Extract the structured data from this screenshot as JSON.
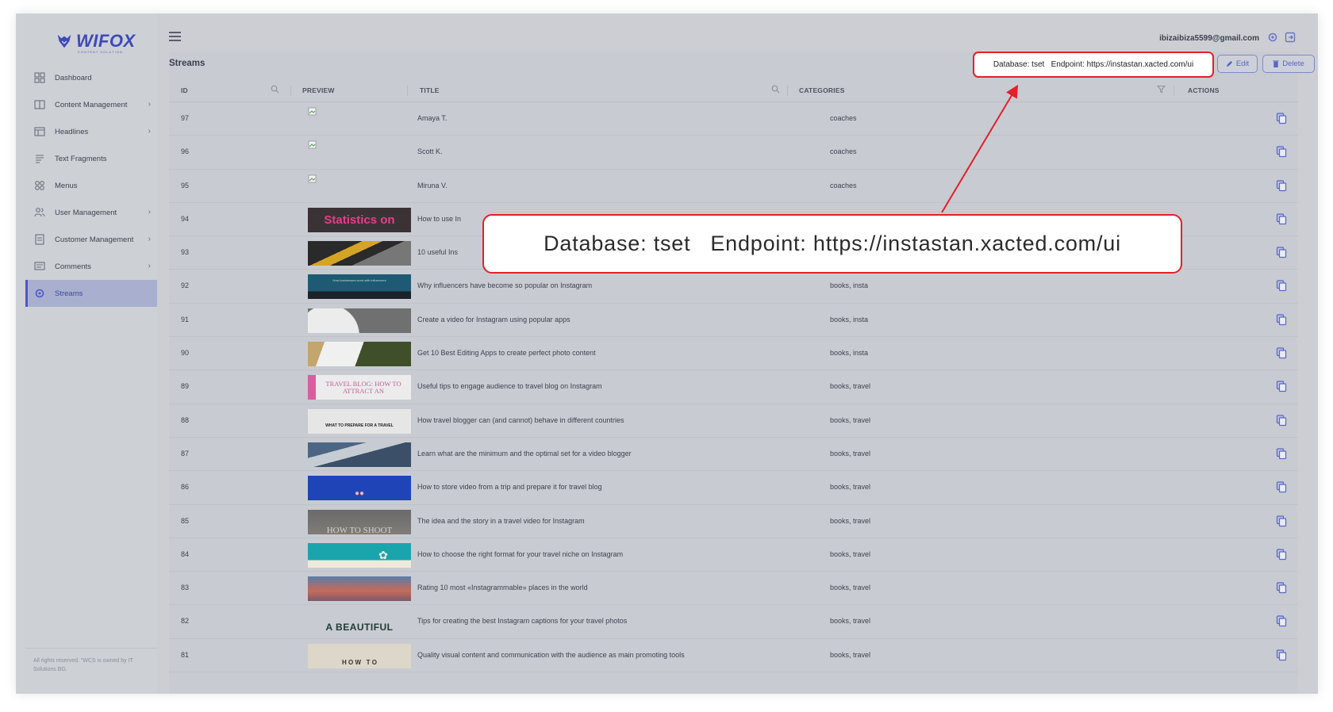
{
  "brand": {
    "name": "WIFOX",
    "tagline": "CONTENT SOLUTION"
  },
  "sidebar": {
    "items": [
      {
        "label": "Dashboard",
        "icon": "dashboard-icon",
        "chevron": false
      },
      {
        "label": "Content Management",
        "icon": "content-icon",
        "chevron": true
      },
      {
        "label": "Headlines",
        "icon": "headlines-icon",
        "chevron": true
      },
      {
        "label": "Text Fragments",
        "icon": "text-icon",
        "chevron": false
      },
      {
        "label": "Menus",
        "icon": "menus-icon",
        "chevron": false
      },
      {
        "label": "User Management",
        "icon": "users-icon",
        "chevron": true
      },
      {
        "label": "Customer Management",
        "icon": "customer-icon",
        "chevron": true
      },
      {
        "label": "Comments",
        "icon": "comments-icon",
        "chevron": true
      },
      {
        "label": "Streams",
        "icon": "streams-icon",
        "chevron": false,
        "active": true
      }
    ],
    "footer": "All rights reserved. \"WCS is owned by IT Solutions BG."
  },
  "header": {
    "user_email": "ibizaibiza5599@gmail.com"
  },
  "page": {
    "title": "Streams",
    "edit_label": "Edit",
    "delete_label": "Delete",
    "db_info": "Database: tset   Endpoint: https://instastan.xacted.com/ui"
  },
  "callout": {
    "text": "Database: tset   Endpoint: https://instastan.xacted.com/ui",
    "color": "#e3202b"
  },
  "table": {
    "columns": [
      "ID",
      "PREVIEW",
      "TITLE",
      "CATEGORIES",
      "ACTIONS"
    ],
    "rows": [
      {
        "id": "97",
        "title": "Amaya T.",
        "categories": "coaches",
        "preview": "broken"
      },
      {
        "id": "96",
        "title": "Scott K.",
        "categories": "coaches",
        "preview": "broken"
      },
      {
        "id": "95",
        "title": "Miruna V.",
        "categories": "coaches",
        "preview": "broken"
      },
      {
        "id": "94",
        "title": "How to use In",
        "categories": "",
        "preview": "stats",
        "preview_text": "Statistics on"
      },
      {
        "id": "93",
        "title": "10 useful Ins",
        "categories": "",
        "preview": "stripe"
      },
      {
        "id": "92",
        "title": "Why influencers have become so popular on Instagram",
        "categories": "books, insta",
        "preview": "teal",
        "preview_text": "How businesses work with influencers"
      },
      {
        "id": "91",
        "title": "Create a video for Instagram using popular apps",
        "categories": "books, insta",
        "preview": "gray"
      },
      {
        "id": "90",
        "title": "Get 10 Best Editing Apps to create perfect photo content",
        "categories": "books, insta",
        "preview": "phone"
      },
      {
        "id": "89",
        "title": "Useful tips to engage audience to travel blog on Instagram",
        "categories": "books, travel",
        "preview": "travel",
        "preview_text": "TRAVEL BLOG: HOW TO ATTRACT AN"
      },
      {
        "id": "88",
        "title": "How travel blogger can (and cannot) behave in different countries",
        "categories": "books, travel",
        "preview": "prepare",
        "preview_text": "WHAT TO PREPARE FOR A TRAVEL"
      },
      {
        "id": "87",
        "title": "Learn what are the minimum and the optimal set for a video blogger",
        "categories": "books, travel",
        "preview": "mountain"
      },
      {
        "id": "86",
        "title": "How to store video from a trip and prepare it for travel blog",
        "categories": "books, travel",
        "preview": "blue"
      },
      {
        "id": "85",
        "title": "The idea and the story in a travel video for Instagram",
        "categories": "books, travel",
        "preview": "shoot",
        "preview_text": "HOW TO SHOOT"
      },
      {
        "id": "84",
        "title": "How to choose the right format for your travel niche on Instagram",
        "categories": "books, travel",
        "preview": "turquoise"
      },
      {
        "id": "83",
        "title": "Rating 10 most «Instagrammable» places in the world",
        "categories": "books, travel",
        "preview": "sunset"
      },
      {
        "id": "82",
        "title": "Tips for creating the best Instagram captions for your travel photos",
        "categories": "books, travel",
        "preview": "beautiful",
        "preview_text": "A BEAUTIFUL"
      },
      {
        "id": "81",
        "title": "Quality visual content and communication with the audience as main promoting tools",
        "categories": "books, travel",
        "preview": "howto",
        "preview_text": "H O W   T O"
      }
    ]
  }
}
